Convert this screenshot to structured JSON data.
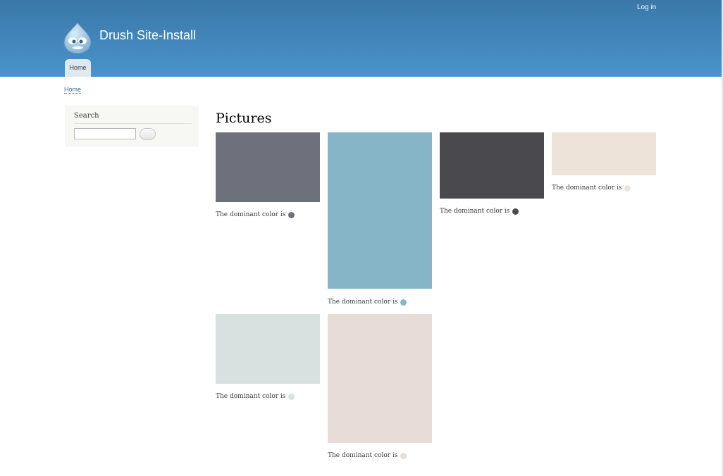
{
  "header": {
    "login_label": "Log in",
    "site_name": "Drush Site-Install",
    "tab_home_label": "Home",
    "logo_icon": "drupal-drop-icon"
  },
  "breadcrumb": {
    "home_label": "Home"
  },
  "sidebar": {
    "search_title": "Search",
    "search_input_value": "",
    "search_button_icon": "search-submit-button"
  },
  "main": {
    "title": "Pictures",
    "pictures": [
      {
        "caption": "The dominant color is",
        "color": "#6e717c"
      },
      {
        "caption": "The dominant color is",
        "color": "#86b5c7"
      },
      {
        "caption": "The dominant color is",
        "color": "#4a494e"
      },
      {
        "caption": "The dominant color is",
        "color": "#ede3d8"
      },
      {
        "caption": "The dominant color is",
        "color": "#d9e0e0"
      },
      {
        "caption": "The dominant color is",
        "color": "#e8dcd9"
      }
    ]
  },
  "colors": {
    "header_top": "#3a78a8",
    "header_bottom": "#4a93cc",
    "link": "#2a6fa8",
    "sidebar_bg": "#f7f7f3"
  }
}
